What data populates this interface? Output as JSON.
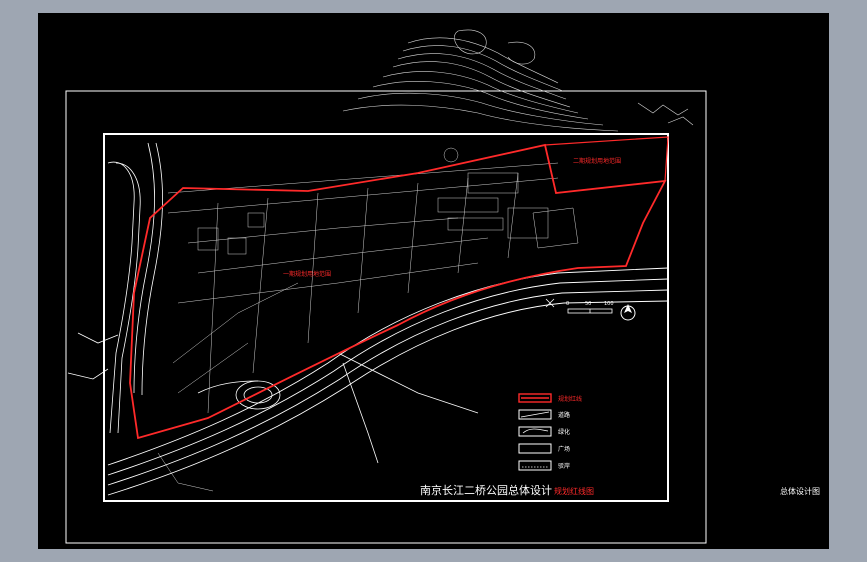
{
  "drawing": {
    "title_main": "南京长江二桥公园总体设计",
    "title_sub": "规划红线图",
    "side_label": "总体设计图",
    "zone_label_1": "一期规划用地范围",
    "zone_label_2": "二期规划用地范围",
    "scale_ticks": [
      "0",
      "50",
      "100"
    ]
  },
  "legend": {
    "items": [
      {
        "label": "规划红线"
      },
      {
        "label": "道路"
      },
      {
        "label": "绿化"
      },
      {
        "label": "广场"
      },
      {
        "label": "驳岸"
      }
    ]
  },
  "colors": {
    "background": "#000000",
    "workspace": "#9ea6b2",
    "boundary": "#ff2a2a",
    "linework": "#ffffff"
  }
}
